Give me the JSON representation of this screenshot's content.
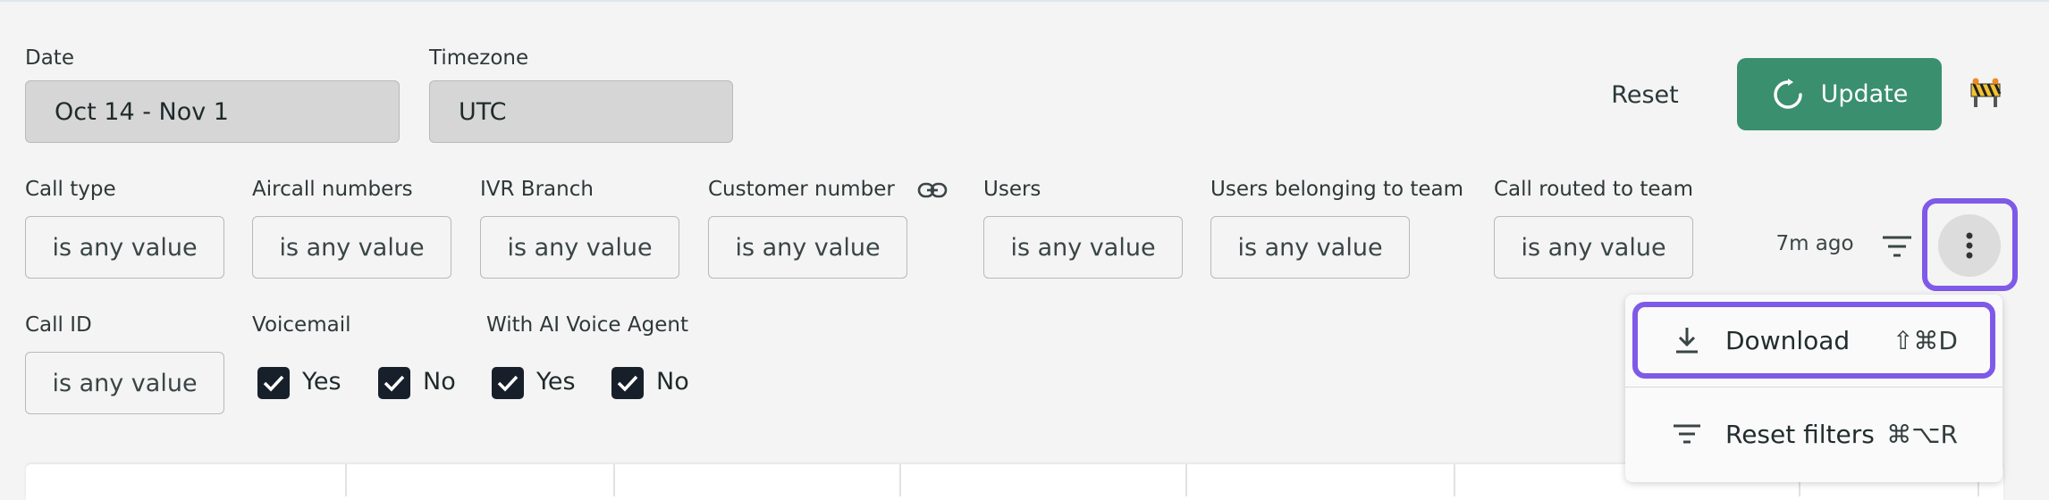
{
  "filters_top": {
    "date": {
      "label": "Date",
      "value": "Oct 14 - Nov 1"
    },
    "timezone": {
      "label": "Timezone",
      "value": "UTC"
    }
  },
  "actions": {
    "reset_label": "Reset",
    "update_label": "Update",
    "update_color": "#3a8f6e",
    "construction_icon": "construction-barrier-icon"
  },
  "filters_row2": [
    {
      "label": "Call type",
      "value": "is any value"
    },
    {
      "label": "Aircall numbers",
      "value": "is any value"
    },
    {
      "label": "IVR Branch",
      "value": "is any value"
    },
    {
      "label": "Customer number",
      "value": "is any value"
    },
    {
      "label": "Users",
      "value": "is any value"
    },
    {
      "label": "Users belonging to team",
      "value": "is any value"
    },
    {
      "label": "Call routed to team",
      "value": "is any value"
    }
  ],
  "status": {
    "last_updated": "7m ago"
  },
  "filters_row3": {
    "call_id": {
      "label": "Call ID",
      "value": "is any value"
    },
    "voicemail": {
      "label": "Voicemail",
      "yes": "Yes",
      "no": "No",
      "yes_checked": true,
      "no_checked": true
    },
    "ai_voice_agent": {
      "label": "With AI Voice Agent",
      "yes": "Yes",
      "no": "No",
      "yes_checked": true,
      "no_checked": true
    }
  },
  "menu": {
    "items": [
      {
        "label": "Download",
        "shortcut": "⇧⌘D",
        "icon": "download-icon"
      },
      {
        "label": "Reset filters",
        "shortcut": "⌘⌥R",
        "icon": "filter-lines-icon"
      }
    ]
  },
  "highlight_color": "#7f59e8"
}
